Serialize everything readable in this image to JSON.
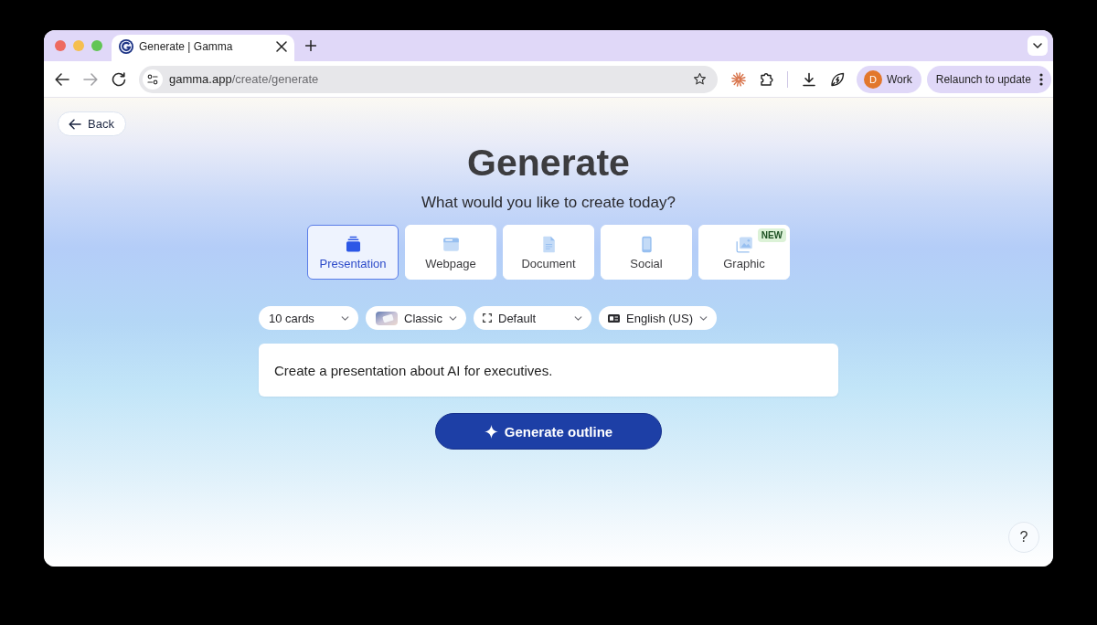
{
  "browser": {
    "tabs": [
      {
        "title": "Generate | Gamma",
        "selected": true
      }
    ],
    "nav_buttons": [
      {
        "kind": "back",
        "disabled": false
      },
      {
        "kind": "forward",
        "disabled": true
      },
      {
        "kind": "reload",
        "disabled": false
      }
    ],
    "address": {
      "host": "gamma.app",
      "path": "/create/generate"
    },
    "profile": {
      "initial": "D",
      "label": "Work"
    },
    "update_button": "Relaunch to update"
  },
  "page": {
    "back_button": "Back",
    "title": "Generate",
    "subtitle": "What would you like to create today?",
    "content_types": [
      {
        "kind": "presentation",
        "label": "Presentation",
        "selected": true
      },
      {
        "kind": "webpage",
        "label": "Webpage",
        "selected": false
      },
      {
        "kind": "document",
        "label": "Document",
        "selected": false
      },
      {
        "kind": "social",
        "label": "Social",
        "selected": false
      },
      {
        "kind": "graphic",
        "label": "Graphic",
        "selected": false,
        "badge": "NEW"
      }
    ],
    "options": [
      {
        "kind": "card_count",
        "value": "10 cards"
      },
      {
        "kind": "theme",
        "value": "Classic"
      },
      {
        "kind": "dimensions",
        "value": "Default"
      },
      {
        "kind": "language",
        "value": "English (US)"
      }
    ],
    "prompt": {
      "value": "Create a presentation about AI for executives."
    },
    "generate_button": "Generate outline",
    "help_button": "?"
  }
}
